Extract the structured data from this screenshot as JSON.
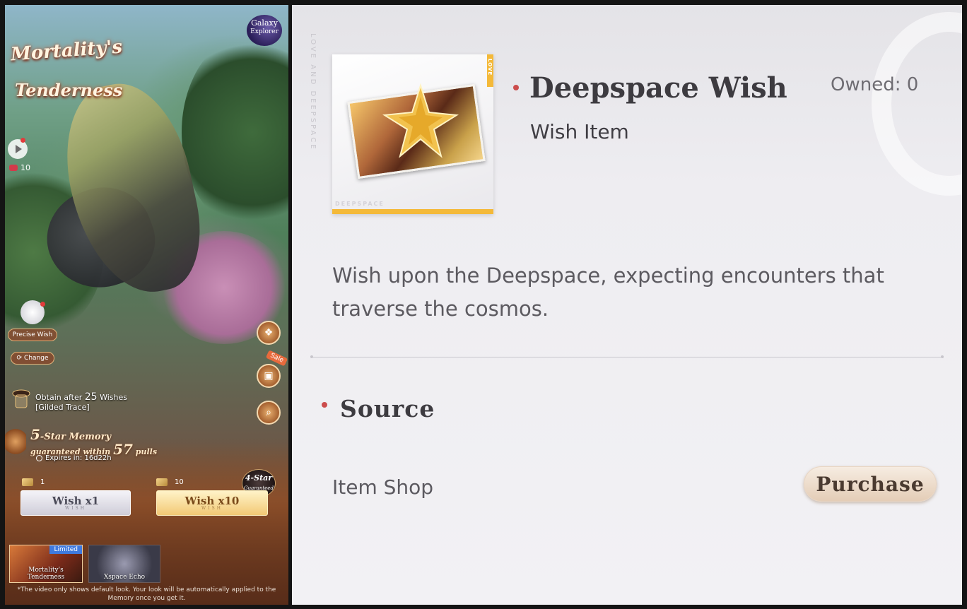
{
  "banner": {
    "title_line1": "Mortality's",
    "title_line2": "Tenderness",
    "galaxy_line1": "Galaxy",
    "galaxy_line2": "Explorer",
    "gem_count": "10",
    "precise_wish_label": "Precise Wish",
    "change_label": "Change",
    "gilded_obtain_prefix": "Obtain after",
    "gilded_count": "25",
    "gilded_obtain_suffix": "Wishes",
    "gilded_trace_label": "[Gilded Trace]",
    "five_star_number": "5",
    "five_star_label": "-Star Memory",
    "guaranteed_label": "guaranteed within",
    "guaranteed_count": "57",
    "pulls_label": "pulls",
    "expires_label": "Expires in: 16d22h",
    "sale_label": "Sale",
    "four_star_label": "4-Star",
    "four_star_sub": "Guaranteed",
    "wish1_cost": "1",
    "wish10_cost": "10",
    "wish1_label": "Wish x1",
    "wish10_label": "Wish x10",
    "wish_sub": "WISH",
    "thumbs": [
      {
        "label": "Mortality's Tenderness",
        "badge": "Limited"
      },
      {
        "label": "Xspace Echo"
      }
    ],
    "disclaimer": "*The video only shows default look. Your look will be automatically applied to the Memory once you get it."
  },
  "detail": {
    "vertical_text": "LOVE AND DEEPSPACE",
    "card_side_label": "LOVE",
    "card_bottom_label": "DEEPSPACE",
    "item_name": "Deepspace Wish",
    "owned": "Owned: 0",
    "item_type": "Wish Item",
    "description": "Wish upon the Deepspace, expecting encounters that traverse the cosmos.",
    "source_title": "Source",
    "source_name": "Item Shop",
    "purchase_label": "Purchase"
  },
  "colors": {
    "bullet": "#cc4d4d",
    "card_gold": "#f4b939",
    "limited_badge": "#3f7adf"
  }
}
